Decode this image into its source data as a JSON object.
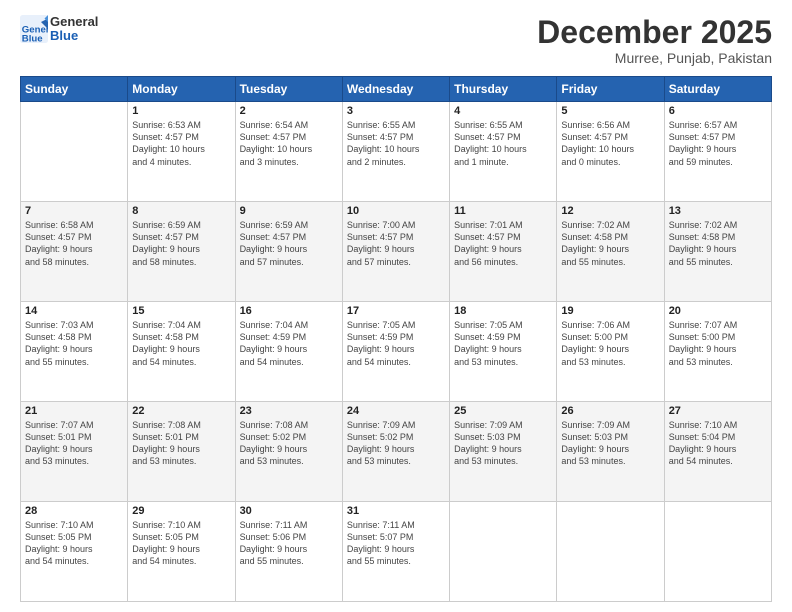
{
  "header": {
    "logo_line1": "General",
    "logo_line2": "Blue",
    "title": "December 2025",
    "subtitle": "Murree, Punjab, Pakistan"
  },
  "days_of_week": [
    "Sunday",
    "Monday",
    "Tuesday",
    "Wednesday",
    "Thursday",
    "Friday",
    "Saturday"
  ],
  "weeks": [
    [
      {
        "day": "",
        "info": ""
      },
      {
        "day": "1",
        "info": "Sunrise: 6:53 AM\nSunset: 4:57 PM\nDaylight: 10 hours\nand 4 minutes."
      },
      {
        "day": "2",
        "info": "Sunrise: 6:54 AM\nSunset: 4:57 PM\nDaylight: 10 hours\nand 3 minutes."
      },
      {
        "day": "3",
        "info": "Sunrise: 6:55 AM\nSunset: 4:57 PM\nDaylight: 10 hours\nand 2 minutes."
      },
      {
        "day": "4",
        "info": "Sunrise: 6:55 AM\nSunset: 4:57 PM\nDaylight: 10 hours\nand 1 minute."
      },
      {
        "day": "5",
        "info": "Sunrise: 6:56 AM\nSunset: 4:57 PM\nDaylight: 10 hours\nand 0 minutes."
      },
      {
        "day": "6",
        "info": "Sunrise: 6:57 AM\nSunset: 4:57 PM\nDaylight: 9 hours\nand 59 minutes."
      }
    ],
    [
      {
        "day": "7",
        "info": "Sunrise: 6:58 AM\nSunset: 4:57 PM\nDaylight: 9 hours\nand 58 minutes."
      },
      {
        "day": "8",
        "info": "Sunrise: 6:59 AM\nSunset: 4:57 PM\nDaylight: 9 hours\nand 58 minutes."
      },
      {
        "day": "9",
        "info": "Sunrise: 6:59 AM\nSunset: 4:57 PM\nDaylight: 9 hours\nand 57 minutes."
      },
      {
        "day": "10",
        "info": "Sunrise: 7:00 AM\nSunset: 4:57 PM\nDaylight: 9 hours\nand 57 minutes."
      },
      {
        "day": "11",
        "info": "Sunrise: 7:01 AM\nSunset: 4:57 PM\nDaylight: 9 hours\nand 56 minutes."
      },
      {
        "day": "12",
        "info": "Sunrise: 7:02 AM\nSunset: 4:58 PM\nDaylight: 9 hours\nand 55 minutes."
      },
      {
        "day": "13",
        "info": "Sunrise: 7:02 AM\nSunset: 4:58 PM\nDaylight: 9 hours\nand 55 minutes."
      }
    ],
    [
      {
        "day": "14",
        "info": "Sunrise: 7:03 AM\nSunset: 4:58 PM\nDaylight: 9 hours\nand 55 minutes."
      },
      {
        "day": "15",
        "info": "Sunrise: 7:04 AM\nSunset: 4:58 PM\nDaylight: 9 hours\nand 54 minutes."
      },
      {
        "day": "16",
        "info": "Sunrise: 7:04 AM\nSunset: 4:59 PM\nDaylight: 9 hours\nand 54 minutes."
      },
      {
        "day": "17",
        "info": "Sunrise: 7:05 AM\nSunset: 4:59 PM\nDaylight: 9 hours\nand 54 minutes."
      },
      {
        "day": "18",
        "info": "Sunrise: 7:05 AM\nSunset: 4:59 PM\nDaylight: 9 hours\nand 53 minutes."
      },
      {
        "day": "19",
        "info": "Sunrise: 7:06 AM\nSunset: 5:00 PM\nDaylight: 9 hours\nand 53 minutes."
      },
      {
        "day": "20",
        "info": "Sunrise: 7:07 AM\nSunset: 5:00 PM\nDaylight: 9 hours\nand 53 minutes."
      }
    ],
    [
      {
        "day": "21",
        "info": "Sunrise: 7:07 AM\nSunset: 5:01 PM\nDaylight: 9 hours\nand 53 minutes."
      },
      {
        "day": "22",
        "info": "Sunrise: 7:08 AM\nSunset: 5:01 PM\nDaylight: 9 hours\nand 53 minutes."
      },
      {
        "day": "23",
        "info": "Sunrise: 7:08 AM\nSunset: 5:02 PM\nDaylight: 9 hours\nand 53 minutes."
      },
      {
        "day": "24",
        "info": "Sunrise: 7:09 AM\nSunset: 5:02 PM\nDaylight: 9 hours\nand 53 minutes."
      },
      {
        "day": "25",
        "info": "Sunrise: 7:09 AM\nSunset: 5:03 PM\nDaylight: 9 hours\nand 53 minutes."
      },
      {
        "day": "26",
        "info": "Sunrise: 7:09 AM\nSunset: 5:03 PM\nDaylight: 9 hours\nand 53 minutes."
      },
      {
        "day": "27",
        "info": "Sunrise: 7:10 AM\nSunset: 5:04 PM\nDaylight: 9 hours\nand 54 minutes."
      }
    ],
    [
      {
        "day": "28",
        "info": "Sunrise: 7:10 AM\nSunset: 5:05 PM\nDaylight: 9 hours\nand 54 minutes."
      },
      {
        "day": "29",
        "info": "Sunrise: 7:10 AM\nSunset: 5:05 PM\nDaylight: 9 hours\nand 54 minutes."
      },
      {
        "day": "30",
        "info": "Sunrise: 7:11 AM\nSunset: 5:06 PM\nDaylight: 9 hours\nand 55 minutes."
      },
      {
        "day": "31",
        "info": "Sunrise: 7:11 AM\nSunset: 5:07 PM\nDaylight: 9 hours\nand 55 minutes."
      },
      {
        "day": "",
        "info": ""
      },
      {
        "day": "",
        "info": ""
      },
      {
        "day": "",
        "info": ""
      }
    ]
  ]
}
